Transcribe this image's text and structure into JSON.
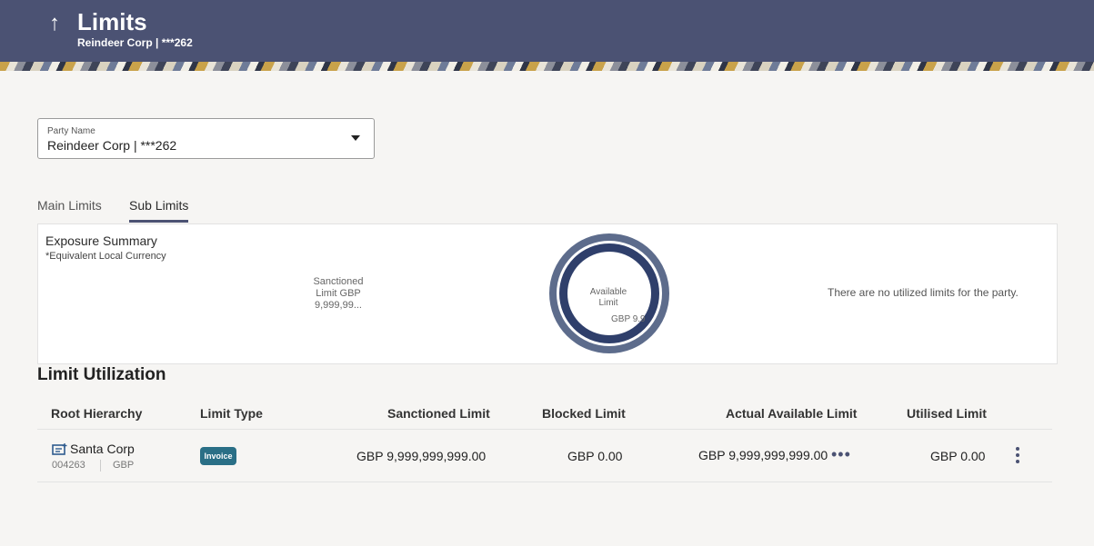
{
  "header": {
    "title": "Limits",
    "subtitle": "Reindeer Corp | ***262",
    "back_icon": "arrow-up-icon"
  },
  "party_select": {
    "label": "Party Name",
    "value": "Reindeer Corp | ***262"
  },
  "tabs": [
    {
      "label": "Main Limits",
      "active": false
    },
    {
      "label": "Sub Limits",
      "active": true
    }
  ],
  "exposure_summary": {
    "title": "Exposure Summary",
    "note": "*Equivalent Local Currency",
    "sanctioned_text": "Sanctioned\nLimit GBP\n9,999,99...",
    "available_label": "Available\nLimit",
    "available_value": "GBP 9.9",
    "no_utilized_message": "There are no utilized limits for the party."
  },
  "limit_utilization": {
    "title": "Limit Utilization",
    "columns": [
      "Root Hierarchy",
      "Limit Type",
      "Sanctioned Limit",
      "Blocked Limit",
      "Actual Available Limit",
      "Utilised Limit"
    ],
    "rows": [
      {
        "name": "Santa Corp",
        "id": "004263",
        "currency": "GBP",
        "limit_type": "Invoice",
        "sanctioned": "GBP 9,999,999,999.00",
        "blocked": "GBP 0.00",
        "actual_available": "GBP 9,999,999,999.00",
        "utilised": "GBP 0.00"
      }
    ]
  },
  "colors": {
    "header_bg": "#4b5273",
    "badge_bg": "#2a6f86",
    "donut_outer": "#5d6c8c",
    "donut_inner": "#2f3f6b"
  }
}
